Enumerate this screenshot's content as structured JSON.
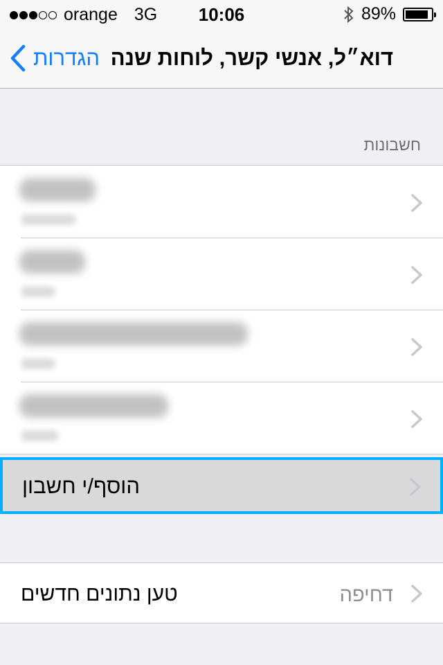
{
  "status_bar": {
    "carrier": "orange",
    "network": "3G",
    "time": "10:06",
    "battery": "89%",
    "battery_level": 0.89,
    "signal_bars_filled": 3,
    "signal_bars_total": 5
  },
  "nav": {
    "back_label": "הגדרות",
    "title": "דוא״ל, אנשי קשר, לוחות שנה"
  },
  "accounts_section": {
    "header": "חשבונות",
    "rows": [
      {
        "blurred": true
      },
      {
        "blurred": true
      },
      {
        "blurred": true
      },
      {
        "blurred": true
      }
    ],
    "add_account_label": "הוסף/י חשבון"
  },
  "fetch_section": {
    "label": "טען נתונים חדשים",
    "value": "דחיפה"
  },
  "colors": {
    "accent": "#147efb",
    "highlight_border": "#00b0ff",
    "background": "#efeff4",
    "secondary_text": "#8e8e93"
  }
}
